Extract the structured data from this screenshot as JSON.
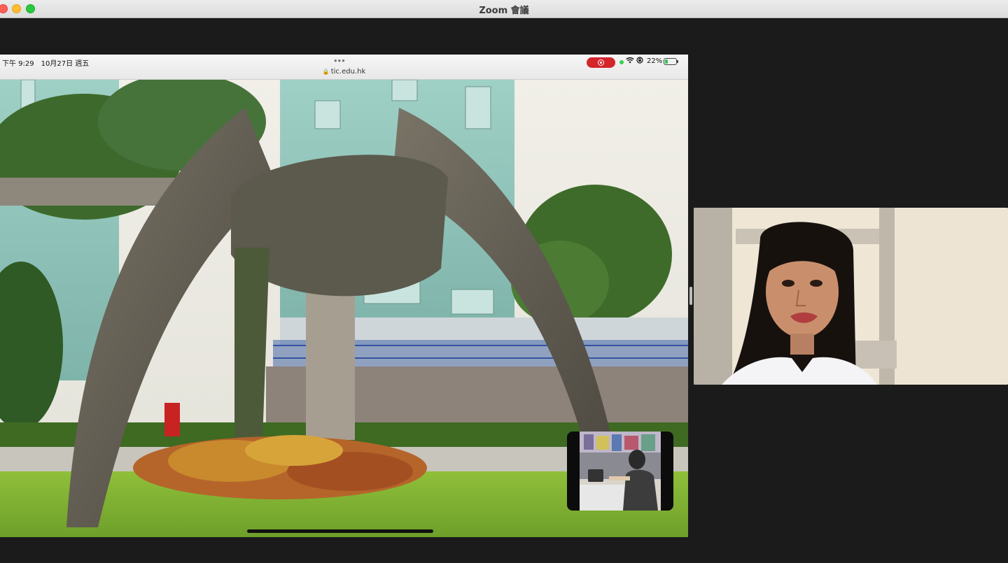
{
  "window": {
    "title": "Zoom 會議"
  },
  "shared_screen": {
    "status_bar": {
      "time_date": "下午 9:29　10月27日 週五",
      "more_dots": "•••",
      "url": "tic.edu.hk",
      "battery_percent": "22%"
    }
  },
  "icons": {
    "lock": "lock-icon",
    "record": "screen-record-icon",
    "wifi": "wifi-icon",
    "orientation_lock": "orientation-lock-icon",
    "battery": "battery-charging-icon"
  },
  "colors": {
    "record_pill": "#d4252c",
    "battery_fill": "#34c759",
    "zoom_background": "#1b1b1b"
  }
}
